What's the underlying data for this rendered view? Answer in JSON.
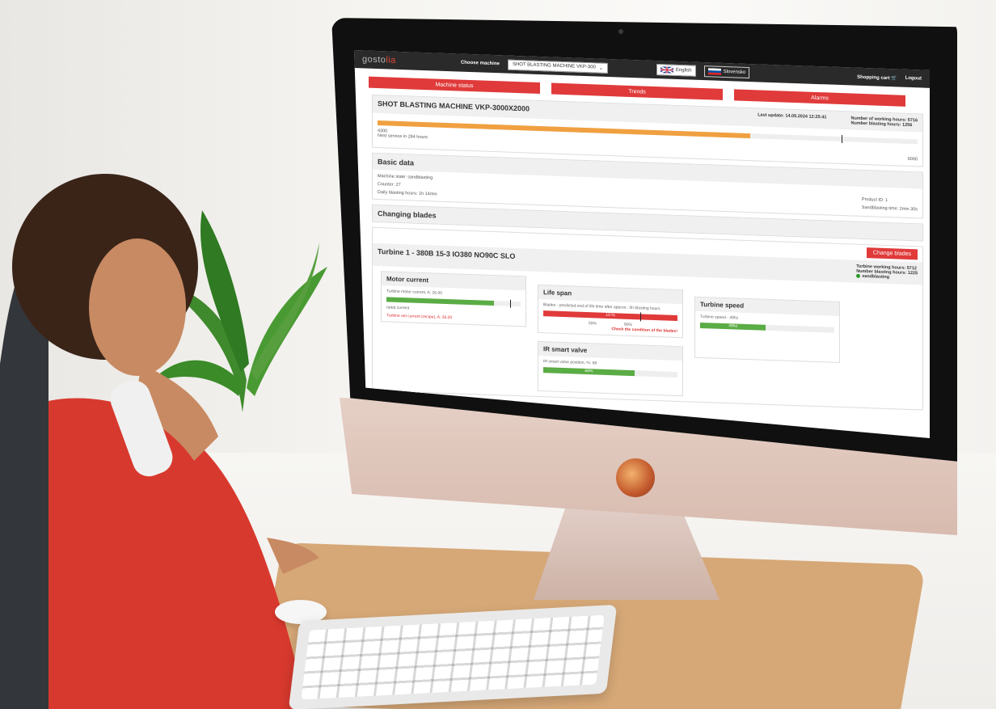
{
  "header": {
    "brand_left": "gosto",
    "brand_right": "lia",
    "choose_label": "Choose machine",
    "machine_selected": "SHOT BLASTING MACHINE VKP-300",
    "lang_en": "English",
    "lang_sl": "Slovensko",
    "cart": "Shopping cart",
    "logout": "Logout"
  },
  "tabs": [
    "Machine status",
    "Trends",
    "Alarms"
  ],
  "machine": {
    "title": "SHOT BLASTING MACHINE VKP-3000X2000",
    "last_update": "Last update: 14.05.2024 12:25:41",
    "working_hours": "Number of working hours: 5716",
    "blasting_hours": "Number blasting hours: 1256",
    "bar_min": "4300",
    "next_service": "Next service in 284 hours",
    "bar_max": "6000",
    "service_progress": 0.69,
    "service_marker": 0.86
  },
  "basic": {
    "title": "Basic data",
    "state": "Machine state: sandblasting",
    "counter": "Counter: 27",
    "daily": "Daily blasting hours: 1h 14min",
    "product": "Product ID: 1",
    "sand_time": "Sandblasting time: 2min 30s"
  },
  "blades": {
    "title": "Changing blades",
    "button": "Change blades"
  },
  "turbine": {
    "title": "Turbine 1 - 380B 15-3 IO380 NO90C SLO",
    "working": "Turbine working hours: 5712",
    "blasting": "Number blasting hours: 1225",
    "state": "sandblasting"
  },
  "panels": {
    "motor": {
      "title": "Motor current",
      "current": "Turbine motor current, A: 26.00",
      "rated": "rated current",
      "set": "Turbine set current (recipe), A: 26.00",
      "fill": 0.8
    },
    "life": {
      "title": "Life span",
      "desc": "Blades - predicted end of life time after approx.: 0h blasting hours",
      "bar_label": "10 %",
      "t50": "50%",
      "t80": "80%",
      "warning": "Check the condition of the blades!",
      "fill": 1.0
    },
    "ir": {
      "title": "IR smart valve",
      "desc": "IR smart valve position, %: 68",
      "bar_label": "68%",
      "fill": 0.68
    },
    "speed": {
      "title": "Turbine speed",
      "desc": "Turbine speed - 49hz",
      "bar_label": "49hz",
      "fill": 0.49
    }
  },
  "colors": {
    "accent_red": "#e03a3a",
    "orange_bar": "#f0a040",
    "green_bar": "#5aac44"
  }
}
